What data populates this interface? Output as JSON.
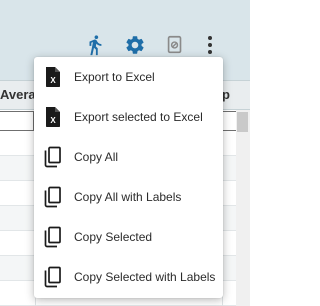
{
  "toolbar": {
    "icons": [
      "run-icon",
      "gear-icon",
      "no-edit-icon",
      "more-vert-icon"
    ],
    "accent_color": "#1f6ea8"
  },
  "grid": {
    "column_header_left": "Avera",
    "column_header_right": "p"
  },
  "menu": {
    "items": [
      {
        "label": "Export to Excel",
        "icon": "excel-file-icon"
      },
      {
        "label": "Export selected to Excel",
        "icon": "excel-file-icon"
      },
      {
        "label": "Copy All",
        "icon": "copy-icon"
      },
      {
        "label": "Copy All with Labels",
        "icon": "copy-icon"
      },
      {
        "label": "Copy Selected",
        "icon": "copy-icon"
      },
      {
        "label": "Copy Selected with Labels",
        "icon": "copy-icon"
      }
    ]
  }
}
